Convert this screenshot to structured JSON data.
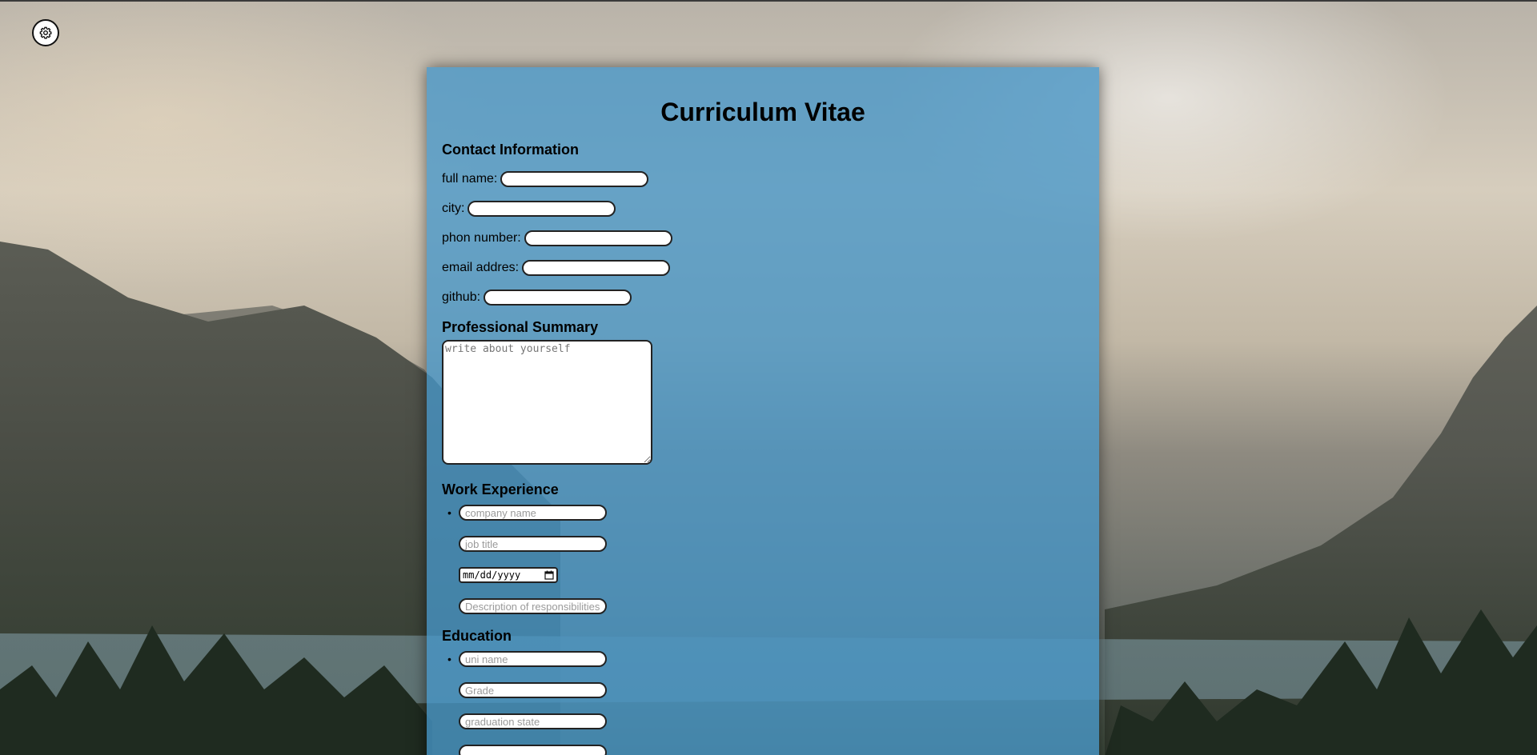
{
  "settings": {
    "icon": "gear-icon"
  },
  "cv": {
    "title": "Curriculum Vitae",
    "contact": {
      "heading": "Contact Information",
      "fields": [
        {
          "label": "full name:",
          "value": ""
        },
        {
          "label": "city:",
          "value": ""
        },
        {
          "label": "phon number:",
          "value": ""
        },
        {
          "label": "email addres:",
          "value": ""
        },
        {
          "label": "github:",
          "value": ""
        }
      ]
    },
    "summary": {
      "heading": "Professional Summary",
      "placeholder": "write about yourself"
    },
    "work": {
      "heading": "Work Experience",
      "company_placeholder": "company name",
      "job_placeholder": "job title",
      "date_placeholder": "mm/dd/yyyy",
      "description_placeholder": "Description of responsibilities"
    },
    "education": {
      "heading": "Education",
      "uni_placeholder": "uni name",
      "grade_placeholder": "Grade",
      "graduation_placeholder": "graduation state"
    }
  }
}
